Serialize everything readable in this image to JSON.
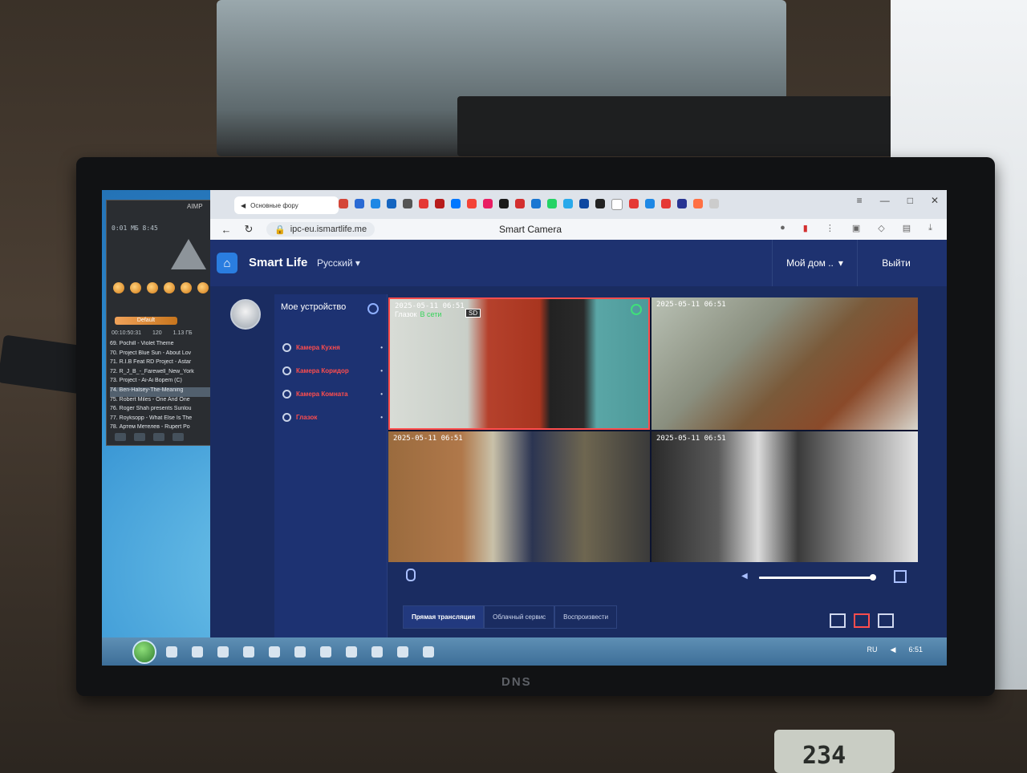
{
  "surroundings": {
    "monitor_brand": "DNS",
    "thermometer_value": "234"
  },
  "aimp": {
    "title": "AIMP",
    "time": "0:01 МБ      8:45",
    "button_label": "Default",
    "stats": [
      "00:10:50:31",
      "120",
      "1.13 ГБ"
    ],
    "playlist": [
      "69. Pochill - Violet Theme",
      "70. Project Blue Sun - About Lov",
      "71. R.I.B Feat RD Project - Astar",
      "72. R_J_B_-_Farewell_New_York",
      "73. Project - Ai-Ai Bopem (C)",
      "74. Ben-Halsey-The-Meaning",
      "75. Robert Miles - One And One",
      "76. Roger Shah presents Sunlou",
      "77. Royksopp - What Else Is The",
      "78. Артем Метелев - Rupert Po"
    ],
    "selected_index": 5
  },
  "browser": {
    "tab_label": "Основные фору",
    "url": "ipc-eu.ismartlife.me",
    "page_title": "Smart Camera",
    "window_controls": [
      "≡",
      "—",
      "□",
      "✕"
    ]
  },
  "app": {
    "brand": "Smart Life",
    "language": "Русский",
    "home_menu": "Мой дом ..",
    "logout": "Выйти",
    "sidebar_title": "Мое устройство",
    "devices": [
      "Камера Кухня",
      "Камера Коридор",
      "Камера Комната",
      "Глазок"
    ],
    "cameras": [
      {
        "timestamp": "2025-05-11 06:51",
        "name": "Глазок",
        "status": "В сети",
        "badge": "SD"
      },
      {
        "timestamp": "2025-05-11 06:51"
      },
      {
        "timestamp": "2025-05-11 06:51"
      },
      {
        "timestamp": "2025-05-11 06:51"
      }
    ],
    "volume_level": 1.0,
    "tabs": [
      "Прямая трансляция",
      "Облачный сервис",
      "Воспроизвести"
    ]
  },
  "taskbar": {
    "language": "RU",
    "clock": "6:51"
  }
}
